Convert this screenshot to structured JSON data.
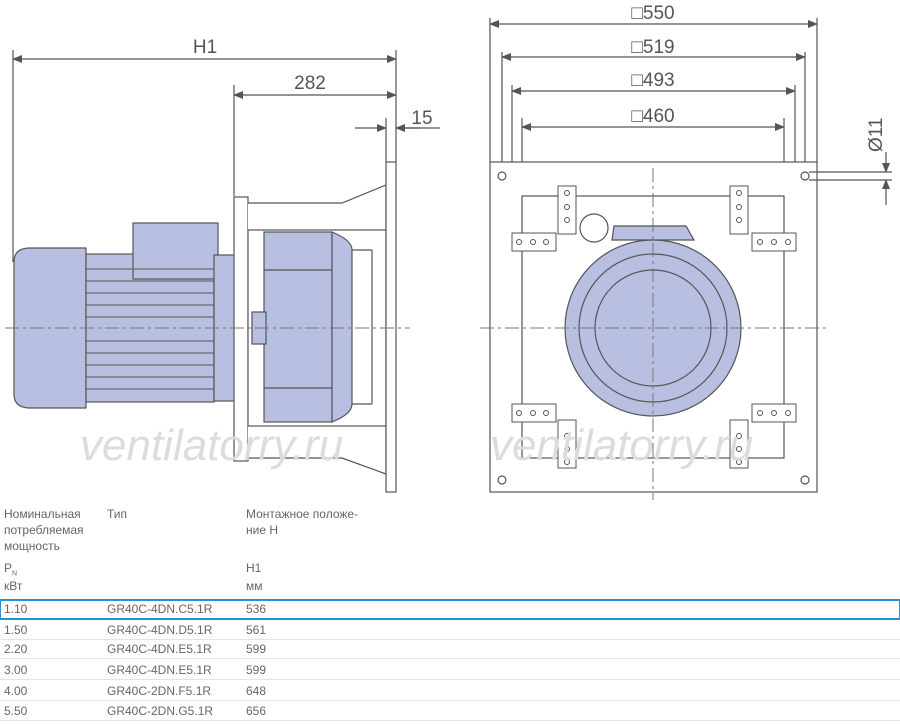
{
  "dimensions": {
    "h1": "H1",
    "d282": "282",
    "d15": "15",
    "sq550": "□550",
    "sq519": "□519",
    "sq493": "□493",
    "sq460": "□460",
    "dia11": "Ø11"
  },
  "watermark": "ventilatorry.ru",
  "colors": {
    "motor_fill": "#b9bfe0",
    "line": "#555555",
    "highlight": "#2a8fd6"
  },
  "table": {
    "headers": {
      "col1": [
        "Номинальная",
        "потребляемая",
        "мощность"
      ],
      "col2": "Тип",
      "col3": [
        "Монтажное положе-",
        "ние H"
      ]
    },
    "subheaders": {
      "col1_symbol": "P",
      "col1_sub": "N",
      "col3": "H1"
    },
    "units": {
      "col1": "кВт",
      "col3": "мм"
    },
    "rows": [
      {
        "power": "1.10",
        "type": "GR40C-4DN.C5.1R",
        "h1": "536",
        "selected": true
      },
      {
        "power": "1.50",
        "type": "GR40C-4DN.D5.1R",
        "h1": "561"
      },
      {
        "power": "2.20",
        "type": "GR40C-4DN.E5.1R",
        "h1": "599"
      },
      {
        "power": "3.00",
        "type": "GR40C-4DN.E5.1R",
        "h1": "599"
      },
      {
        "power": "4.00",
        "type": "GR40C-2DN.F5.1R",
        "h1": "648"
      },
      {
        "power": "5.50",
        "type": "GR40C-2DN.G5.1R",
        "h1": "656"
      }
    ]
  }
}
